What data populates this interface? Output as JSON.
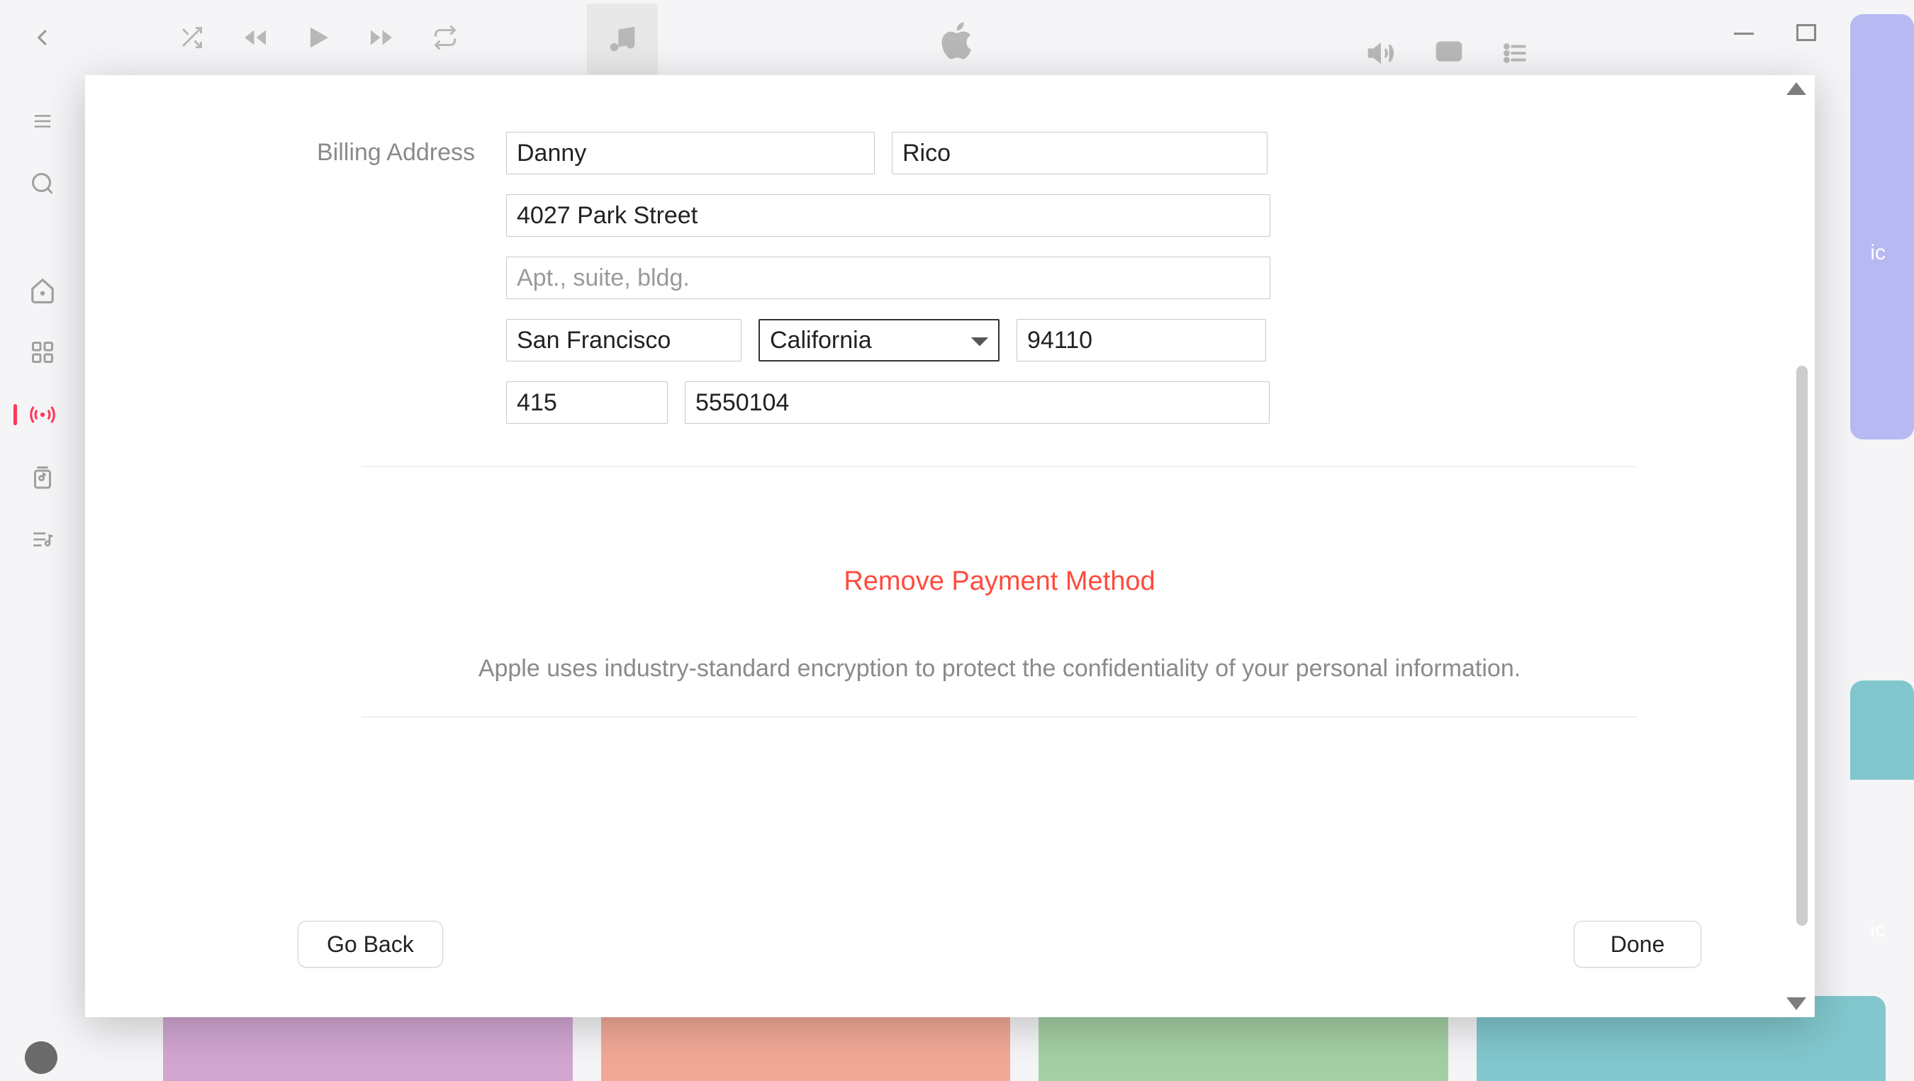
{
  "billing": {
    "section_label": "Billing Address",
    "first_name": "Danny",
    "last_name": "Rico",
    "street": "4027 Park Street",
    "apt_placeholder": "Apt., suite, bldg.",
    "apt": "",
    "city": "San Francisco",
    "state": "California",
    "zip": "94110",
    "area_code": "415",
    "phone": "5550104"
  },
  "actions": {
    "remove_payment": "Remove Payment Method",
    "disclaimer": "Apple uses industry-standard encryption to protect the confidentiality of your personal information.",
    "go_back": "Go Back",
    "done": "Done"
  },
  "background": {
    "tag1": "ic",
    "tag2": "ic"
  }
}
